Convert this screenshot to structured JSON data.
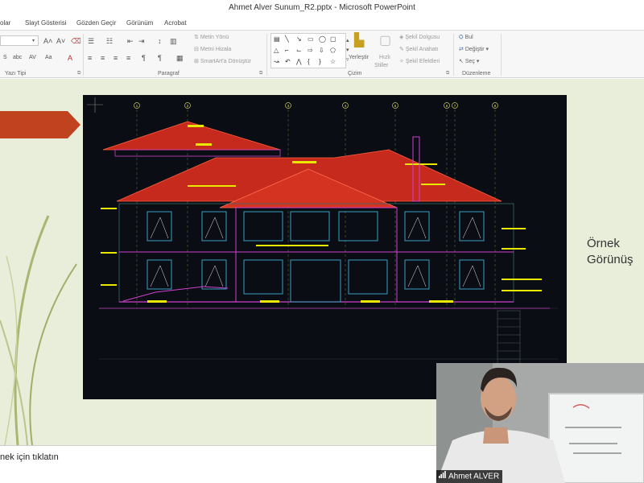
{
  "window": {
    "title": "Ahmet Alver Sunum_R2.pptx - Microsoft PowerPoint"
  },
  "tabs": [
    "olar",
    "Slayt Gösterisi",
    "Gözden Geçir",
    "Görünüm",
    "Acrobat"
  ],
  "ribbon": {
    "font_group": "Yazı Tipi",
    "paragraph_group": "Paragraf",
    "paragraph": {
      "text_direction": "Metin Yönü",
      "align_text": "Metni Hizala",
      "smartart": "SmartArt'a Dönüştür"
    },
    "drawing_group": "Çizim",
    "drawing": {
      "arrange": "Yerleştir",
      "quick_styles_1": "Hızlı",
      "quick_styles_2": "Stiller",
      "shape_fill": "Şekil Dolgusu",
      "shape_outline": "Şekil Anahatı",
      "shape_effects": "Şekil Efektleri"
    },
    "editing_group": "Düzenleme",
    "editing": {
      "find": "Bul",
      "replace": "Değiştir",
      "select": "Seç"
    }
  },
  "slide": {
    "caption_line1": "Örnek",
    "caption_line2": "Görünüş"
  },
  "drawing": {
    "axis_labels": [
      "1",
      "2",
      "3",
      "4",
      "5",
      "6",
      "7",
      "8"
    ]
  },
  "notes": {
    "placeholder": "nek için tıklatın"
  },
  "webcam": {
    "name": "Ahmet ALVER"
  },
  "colors": {
    "accent_arrow": "#c0421e",
    "slide_bg": "#e9eedb",
    "drawing_bg": "#0a0d13",
    "roof": "#c62a1c",
    "cad_yellow": "#e8e800"
  }
}
